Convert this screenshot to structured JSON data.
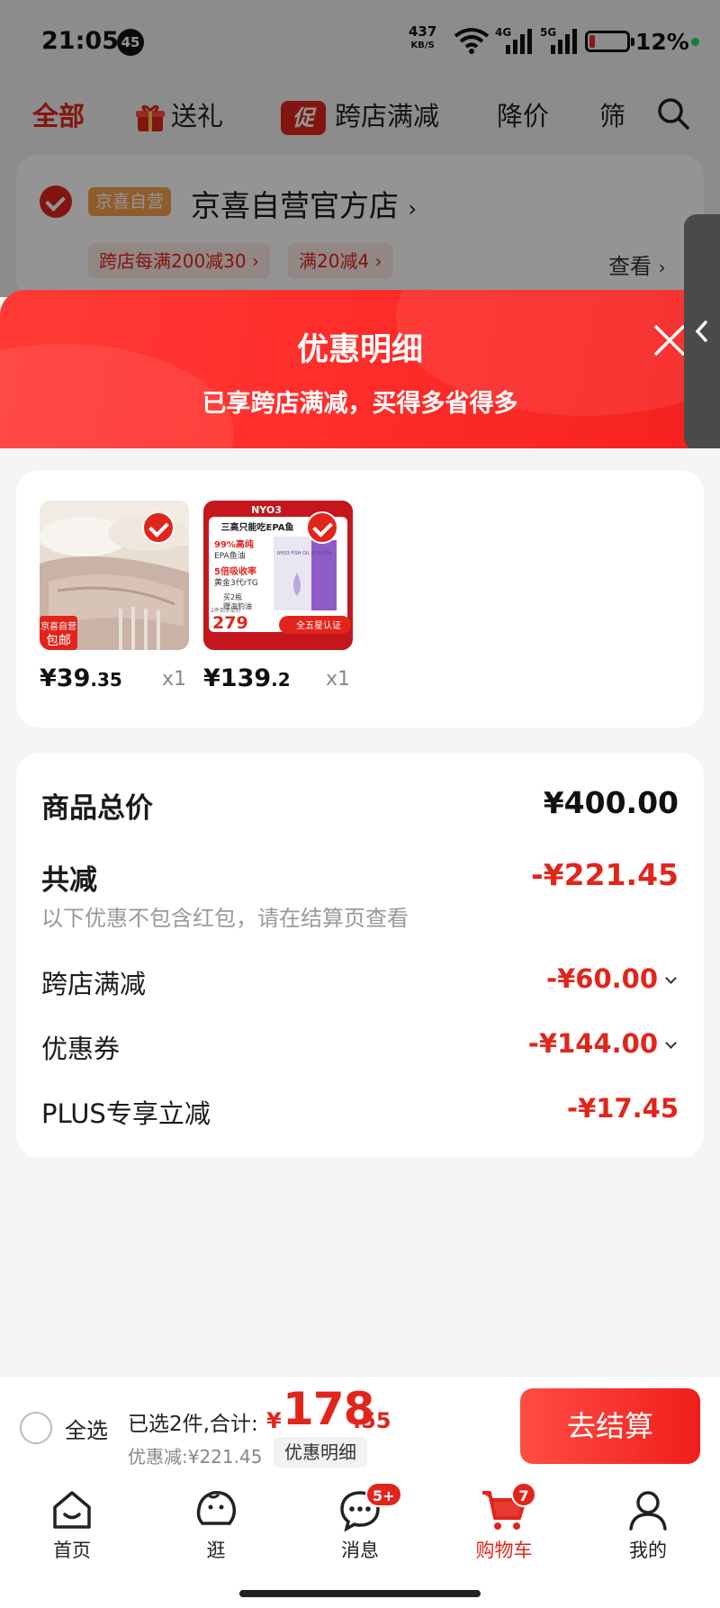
{
  "status_bar": {
    "time": "21:05",
    "notification_count": "45",
    "net_speed": "437",
    "net_speed_unit": "KB/S",
    "signal_1": "4G",
    "signal_2": "5G",
    "battery": "12%"
  },
  "top_tabs": [
    {
      "label": "全部",
      "active": true
    },
    {
      "label": "送礼"
    },
    {
      "label": "跨店满减",
      "icon_text": "促"
    },
    {
      "label": "降价"
    },
    {
      "label": "筛"
    }
  ],
  "store": {
    "tag": "京喜自营",
    "name": "京喜自营官方店",
    "coupons": [
      "跨店每满200减30",
      "满20减4"
    ],
    "view_label": "查看"
  },
  "sheet": {
    "title": "优惠明细",
    "subtitle": "已享跨店满减，买得多省得多"
  },
  "products": [
    {
      "price_int": "¥39",
      "price_dec": ".35",
      "qty": "x1",
      "badge_line1": "京喜自营",
      "badge_line2": "包邮",
      "image": "beige-bedding-photo"
    },
    {
      "price_int": "¥139",
      "price_dec": ".2",
      "qty": "x1",
      "brand": "NYO3",
      "headline": "三高只能吃EPA鱼",
      "feature_1": "99%高纯",
      "feature_1b": "EPA鱼油",
      "feature_2": "5倍吸收率",
      "feature_2b": "黄金3代rTG",
      "feature_3": "买2瓶",
      "feature_3b": "赠海豹油",
      "box_label": "NYO3 FISH OIL 97% EPA",
      "promo_price": "279",
      "promo_note": "2件到手单价",
      "cert": "全五星认证",
      "image": "fish-oil-product"
    }
  ],
  "summary": {
    "total_label": "商品总价",
    "total_value": "¥400.00",
    "reduce_label": "共减",
    "reduce_value": "-¥221.45",
    "note": "以下优惠不包含红包，请在结算页查看",
    "items": [
      {
        "label": "跨店满减",
        "value": "-¥60.00",
        "expandable": true
      },
      {
        "label": "优惠券",
        "value": "-¥144.00",
        "expandable": true
      },
      {
        "label": "PLUS专享立减",
        "value": "-¥17.45",
        "expandable": false
      }
    ]
  },
  "checkout": {
    "select_all": "全选",
    "selected_text": "已选2件,合计:",
    "currency": "¥",
    "total_int": "178",
    "total_dec": ".55",
    "discount_text": "优惠减:¥221.45",
    "detail_label": "优惠明细",
    "button_label": "去结算"
  },
  "nav": [
    {
      "label": "首页",
      "icon": "home-icon"
    },
    {
      "label": "逛",
      "icon": "browse-icon"
    },
    {
      "label": "消息",
      "icon": "message-icon",
      "badge": "5+"
    },
    {
      "label": "购物车",
      "icon": "cart-icon",
      "badge": "7",
      "active": true
    },
    {
      "label": "我的",
      "icon": "profile-icon"
    }
  ],
  "colors": {
    "accent": "#e1251b",
    "header_gradient_start": "#ff3b36",
    "header_gradient_end": "#f5211e"
  }
}
